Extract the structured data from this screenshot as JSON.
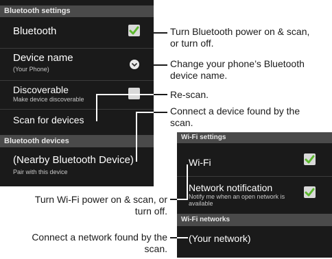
{
  "bluetooth_panel": {
    "header": "Bluetooth settings",
    "bluetooth": {
      "label": "Bluetooth",
      "checked": true
    },
    "device_name": {
      "label": "Device name",
      "subtitle": "(Your Phone)"
    },
    "discoverable": {
      "label": "Discoverable",
      "subtitle": "Make device discoverable",
      "checked": false
    },
    "scan": {
      "label": "Scan for devices"
    },
    "devices_header": "Bluetooth devices",
    "nearby_device": {
      "label": "(Nearby Bluetooth Device)",
      "subtitle": "Pair with this device"
    }
  },
  "wifi_panel": {
    "header": "Wi-Fi settings",
    "wifi": {
      "label": "Wi-Fi",
      "checked": true
    },
    "network_notification": {
      "label": "Network notification",
      "subtitle_line1": "Notify me when an open network is",
      "subtitle_line2": "available",
      "checked": true
    },
    "networks_header": "Wi-Fi networks",
    "your_network": {
      "label": "(Your network)"
    }
  },
  "callouts": {
    "bt_power": [
      "Turn Bluetooth power on & scan,",
      "or turn off."
    ],
    "device_name": [
      "Change your phone’s Bluetooth",
      "device name."
    ],
    "rescan": [
      "Re-scan."
    ],
    "connect_device": [
      "Connect a device found by the",
      "scan."
    ],
    "wifi_power": [
      "Turn Wi-Fi power on & scan, or",
      "turn off."
    ],
    "connect_network": [
      "Connect a network found by the",
      "scan."
    ]
  },
  "colors": {
    "panel_bg": "#1a1a1a",
    "section_header_bg": "#4a4a4a",
    "check_green": "#5cb82e",
    "callout_text": "#1a1a1a"
  },
  "icons": {
    "checkbox": "check-icon",
    "device_name_action": "chevron-down-circle-icon"
  }
}
